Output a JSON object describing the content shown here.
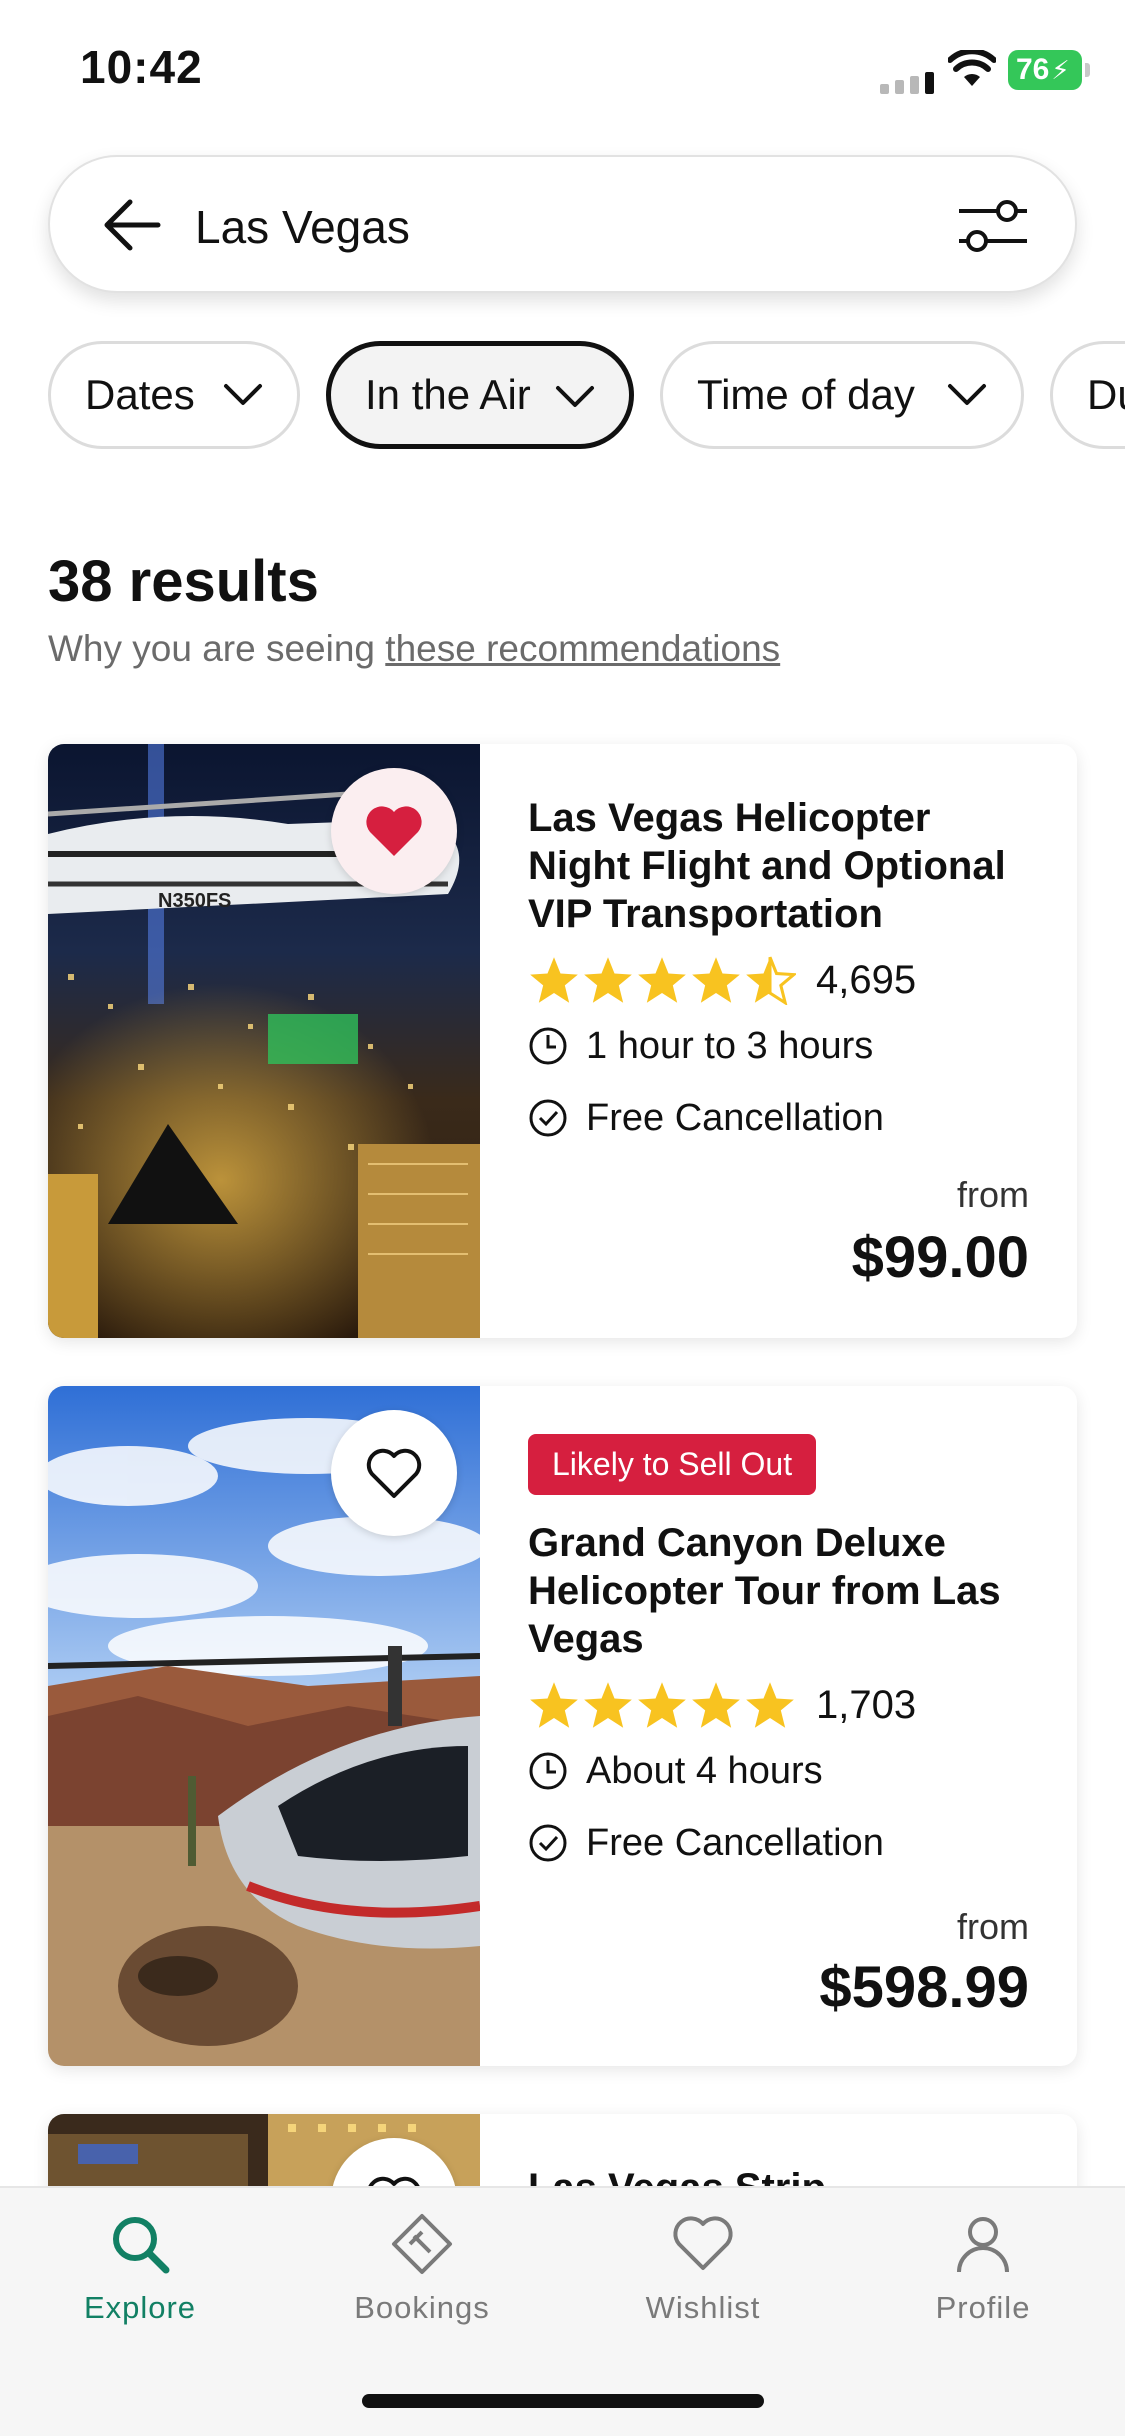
{
  "status_bar": {
    "time": "10:42",
    "battery": "76"
  },
  "search": {
    "query": "Las Vegas"
  },
  "chips": [
    {
      "label": "Dates"
    },
    {
      "label": "In the Air"
    },
    {
      "label": "Time of day"
    },
    {
      "label": "Du"
    }
  ],
  "results": {
    "count_label": "38 results",
    "why_prefix": "Why you are seeing ",
    "why_link": "these recommendations"
  },
  "cards": [
    {
      "title": "Las Vegas Helicopter Night Flight and Optional VIP Transportation",
      "rating_stars": 4.5,
      "rating_count": "4,695",
      "duration": "1 hour to 3 hours",
      "cancellation": "Free Cancellation",
      "price_from": "from",
      "price": "$99.00",
      "favorited": true
    },
    {
      "badge": "Likely to Sell Out",
      "title": "Grand Canyon Deluxe Helicopter Tour from Las Vegas",
      "rating_stars": 5,
      "rating_count": "1,703",
      "duration": "About 4 hours",
      "cancellation": "Free Cancellation",
      "price_from": "from",
      "price": "$598.99",
      "favorited": false
    },
    {
      "title": "Las Vegas Strip",
      "favorited": false
    }
  ],
  "nav": {
    "items": [
      {
        "label": "Explore",
        "icon": "search-icon",
        "active": true
      },
      {
        "label": "Bookings",
        "icon": "ticket-icon",
        "active": false
      },
      {
        "label": "Wishlist",
        "icon": "heart-icon",
        "active": false
      },
      {
        "label": "Profile",
        "icon": "person-icon",
        "active": false
      }
    ]
  },
  "colors": {
    "accent": "#128064",
    "badge": "#d61f3f",
    "star": "#f8c320",
    "heart": "#d61f3f"
  }
}
